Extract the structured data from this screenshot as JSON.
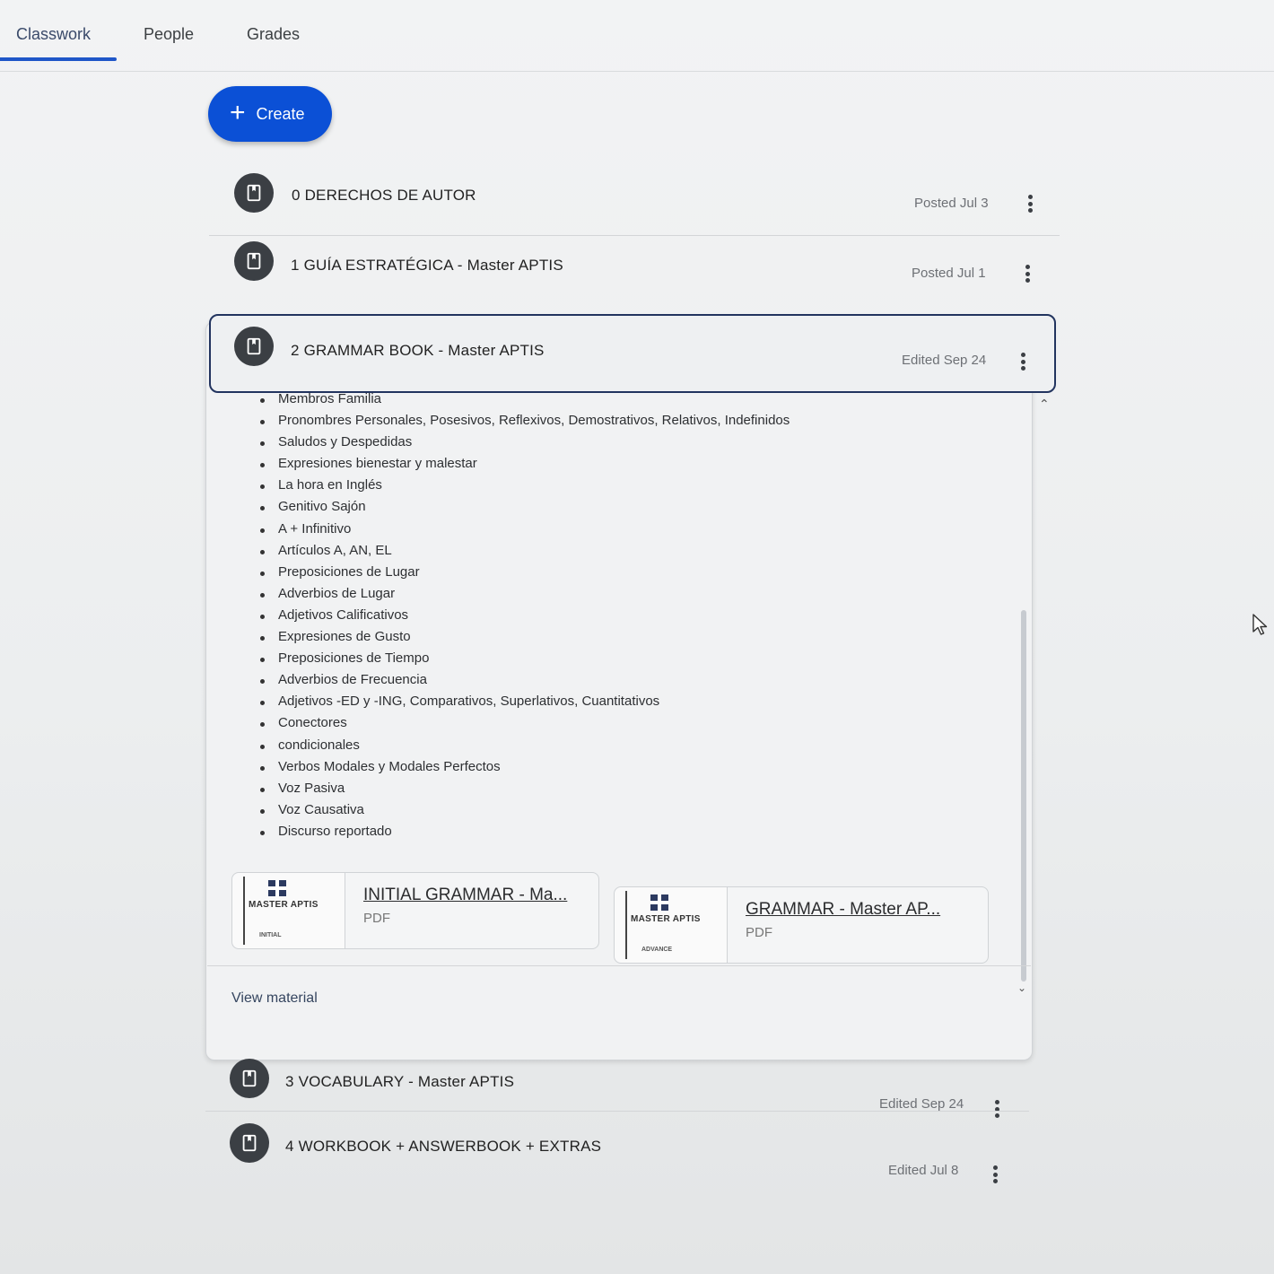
{
  "tabs": [
    {
      "label": "Classwork"
    },
    {
      "label": "People"
    },
    {
      "label": "Grades"
    }
  ],
  "create_button": {
    "label": "Create"
  },
  "materials": [
    {
      "title": "0 DERECHOS DE AUTOR",
      "meta": "Posted Jul 3"
    },
    {
      "title": "1 GUÍA ESTRATÉGICA - Master APTIS",
      "meta": "Posted Jul 1"
    },
    {
      "title": "2 GRAMMAR BOOK - Master APTIS",
      "meta": "Edited Sep 24"
    },
    {
      "title": "3 VOCABULARY - Master APTIS",
      "meta": "Edited Sep 24"
    },
    {
      "title": "4 WORKBOOK + ANSWERBOOK + EXTRAS",
      "meta": "Edited Jul 8"
    }
  ],
  "expanded": {
    "topics": [
      "Membros Familia",
      "Pronombres Personales, Posesivos, Reflexivos, Demostrativos, Relativos, Indefinidos",
      "Saludos y Despedidas",
      "Expresiones bienestar y malestar",
      "La hora en Inglés",
      "Genitivo Sajón",
      "A + Infinitivo",
      "Artículos A, AN, EL",
      "Preposiciones de Lugar",
      "Adverbios de Lugar",
      "Adjetivos Calificativos",
      "Expresiones de Gusto",
      "Preposiciones de Tiempo",
      "Adverbios de Frecuencia",
      "Adjetivos -ED y -ING, Comparativos, Superlativos, Cuantitativos",
      "Conectores",
      "condicionales",
      "Verbos Modales y Modales Perfectos",
      "Voz Pasiva",
      "Voz Causativa",
      "Discurso reportado"
    ],
    "attachments": [
      {
        "title": "INITIAL GRAMMAR - Ma...",
        "type": "PDF",
        "brand": "MASTER APTIS",
        "level": "INITIAL"
      },
      {
        "title": "GRAMMAR - Master AP...",
        "type": "PDF",
        "brand": "MASTER APTIS",
        "level": "ADVANCE"
      }
    ],
    "view_link": "View material"
  },
  "colors": {
    "accent": "#0b50d6",
    "tab_underline": "#1f56c8",
    "icon_bg": "#3b3f44"
  }
}
